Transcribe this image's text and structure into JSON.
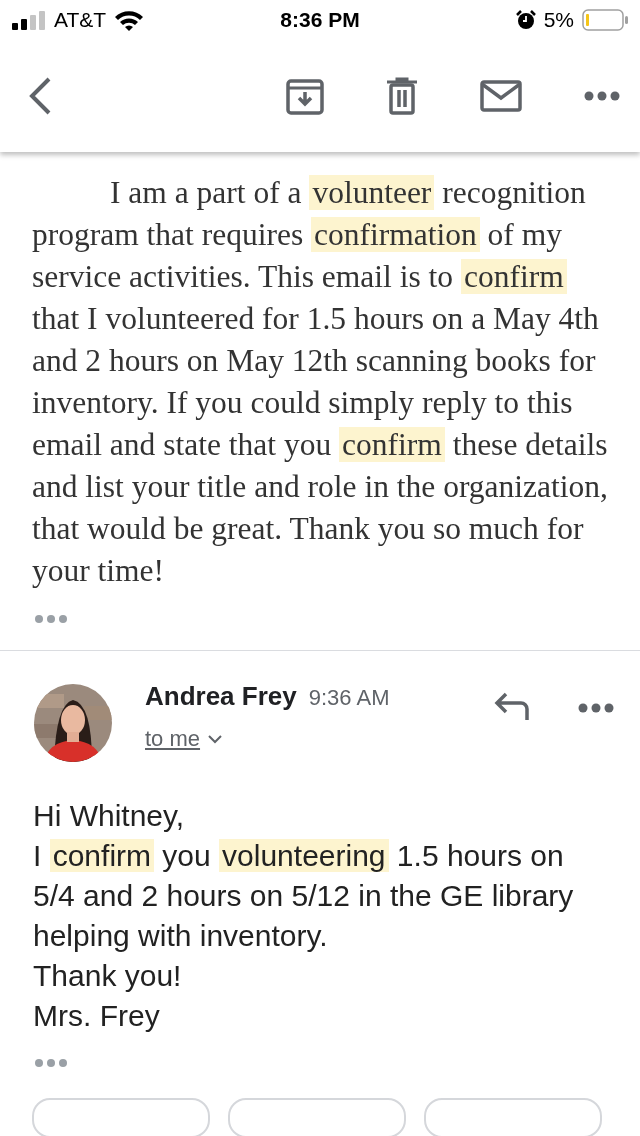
{
  "status_bar": {
    "carrier": "AT&T",
    "time": "8:36 PM",
    "battery_text": "5%"
  },
  "first_message": {
    "segments": [
      {
        "text": "I am a part of a ",
        "highlight": false
      },
      {
        "text": "volunteer",
        "highlight": true
      },
      {
        "text": " recognition program that requires ",
        "highlight": false
      },
      {
        "text": "confirmation",
        "highlight": true
      },
      {
        "text": " of my service activities. This email is to ",
        "highlight": false
      },
      {
        "text": "confirm",
        "highlight": true
      },
      {
        "text": " that I volunteered for 1.5 hours on a May 4th and 2 hours on May 12th scanning books for inventory. If you could simply reply to this email and state that you ",
        "highlight": false
      },
      {
        "text": "confirm",
        "highlight": true
      },
      {
        "text": " these details and list your title and role in the organization, that would be great. Thank you so much for your time!",
        "highlight": false
      }
    ]
  },
  "second_message": {
    "sender": "Andrea Frey",
    "time": "9:36 AM",
    "recipient": "to me",
    "lines": [
      [
        {
          "text": "Hi Whitney,",
          "highlight": false
        }
      ],
      [
        {
          "text": "I ",
          "highlight": false
        },
        {
          "text": "confirm",
          "highlight": true
        },
        {
          "text": " you ",
          "highlight": false
        },
        {
          "text": "volunteering",
          "highlight": true
        },
        {
          "text": " 1.5 hours on 5/4 and 2 hours on 5/12 in the GE library helping with inventory.",
          "highlight": false
        }
      ],
      [
        {
          "text": "Thank you!",
          "highlight": false
        }
      ],
      [
        {
          "text": "Mrs. Frey",
          "highlight": false
        }
      ]
    ]
  }
}
